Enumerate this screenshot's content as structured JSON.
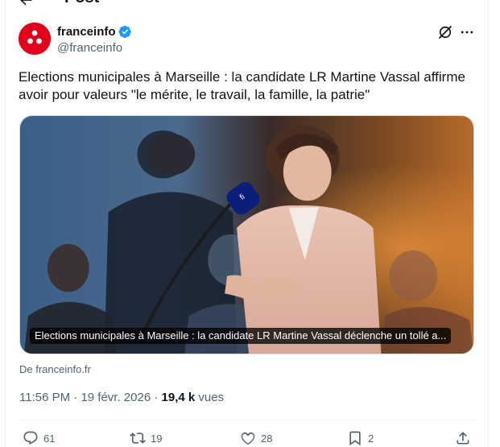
{
  "header": {
    "title": "Post"
  },
  "author": {
    "name": "franceinfo",
    "handle": "@franceinfo"
  },
  "tweet": {
    "text": "Elections municipales à Marseille : la candidate LR Martine Vassal affirme avoir pour valeurs \"le mérite, le travail, la famille, la patrie\""
  },
  "card": {
    "title": "Elections municipales à Marseille : la candidate LR Martine Vassal déclenche un tollé a...",
    "source": "De franceinfo.fr",
    "mic_logo": "fi"
  },
  "meta": {
    "time": "11:56 PM",
    "separator": " · ",
    "date": "19 févr. 2026",
    "views_count": "19,4 k",
    "views_label": " vues"
  },
  "actions": {
    "replies": "61",
    "reposts": "19",
    "likes": "28",
    "bookmarks": "2"
  },
  "colors": {
    "brand_red": "#e3001b",
    "verified_blue": "#1d9bf0",
    "secondary_text": "#536471"
  },
  "icons": [
    "back-arrow-icon",
    "verified-badge-icon",
    "grok-icon",
    "more-icon",
    "reply-icon",
    "repost-icon",
    "like-icon",
    "bookmark-icon",
    "share-icon"
  ]
}
